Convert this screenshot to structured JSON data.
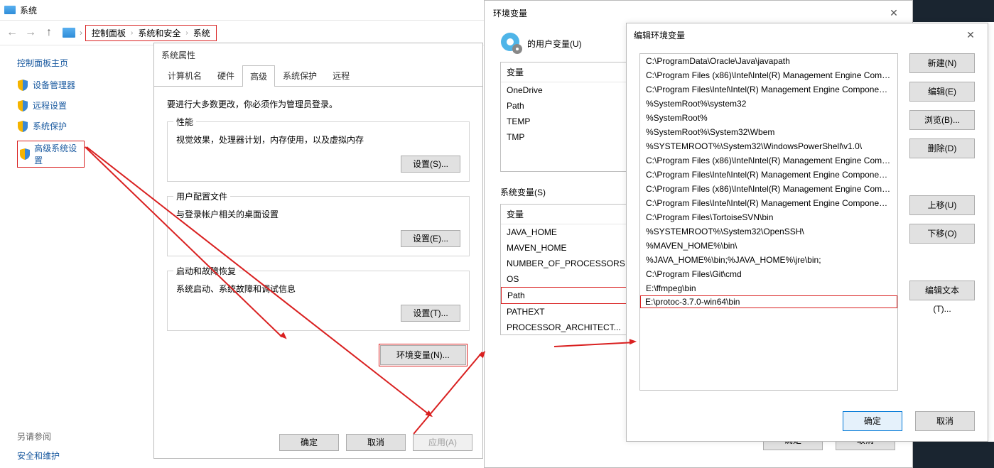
{
  "system": {
    "title": "系统",
    "breadcrumb": [
      "控制面板",
      "系统和安全",
      "系统"
    ],
    "sidebar": {
      "home": "控制面板主页",
      "items": [
        {
          "label": "设备管理器"
        },
        {
          "label": "远程设置"
        },
        {
          "label": "系统保护"
        },
        {
          "label": "高级系统设置"
        }
      ],
      "extra": [
        "另请参阅",
        "安全和维护"
      ]
    }
  },
  "sysprops": {
    "title": "系统属性",
    "tabs": [
      "计算机名",
      "硬件",
      "高级",
      "系统保护",
      "远程"
    ],
    "note": "要进行大多数更改，你必须作为管理员登录。",
    "perf": {
      "label": "性能",
      "desc": "视觉效果，处理器计划，内存使用，以及虚拟内存",
      "btn": "设置(S)..."
    },
    "profile": {
      "label": "用户配置文件",
      "desc": "与登录帐户相关的桌面设置",
      "btn": "设置(E)..."
    },
    "startup": {
      "label": "启动和故障恢复",
      "desc": "系统启动、系统故障和调试信息",
      "btn": "设置(T)..."
    },
    "envbtn": "环境变量(N)...",
    "footer": {
      "ok": "确定",
      "cancel": "取消",
      "apply": "应用(A)"
    }
  },
  "envdlg": {
    "title": "环境变量",
    "user_section": "的用户变量(U)",
    "var_header": "变量",
    "user_vars": [
      "OneDrive",
      "Path",
      "TEMP",
      "TMP"
    ],
    "sys_section": "系统变量(S)",
    "sys_vars": [
      "JAVA_HOME",
      "MAVEN_HOME",
      "NUMBER_OF_PROCESSORS",
      "OS",
      "Path",
      "PATHEXT",
      "PROCESSOR_ARCHITECT..."
    ],
    "footer": {
      "ok": "确定",
      "cancel": "取消"
    }
  },
  "editdlg": {
    "title": "编辑环境变量",
    "paths": [
      "C:\\ProgramData\\Oracle\\Java\\javapath",
      "C:\\Program Files (x86)\\Intel\\Intel(R) Management Engine Comp...",
      "C:\\Program Files\\Intel\\Intel(R) Management Engine Component...",
      "%SystemRoot%\\system32",
      "%SystemRoot%",
      "%SystemRoot%\\System32\\Wbem",
      "%SYSTEMROOT%\\System32\\WindowsPowerShell\\v1.0\\",
      "C:\\Program Files (x86)\\Intel\\Intel(R) Management Engine Comp...",
      "C:\\Program Files\\Intel\\Intel(R) Management Engine Component...",
      "C:\\Program Files (x86)\\Intel\\Intel(R) Management Engine Comp...",
      "C:\\Program Files\\Intel\\Intel(R) Management Engine Component...",
      "C:\\Program Files\\TortoiseSVN\\bin",
      "%SYSTEMROOT%\\System32\\OpenSSH\\",
      "%MAVEN_HOME%\\bin\\",
      "%JAVA_HOME%\\bin;%JAVA_HOME%\\jre\\bin;",
      "C:\\Program Files\\Git\\cmd",
      "E:\\ffmpeg\\bin",
      "E:\\protoc-3.7.0-win64\\bin"
    ],
    "buttons": {
      "new": "新建(N)",
      "edit": "编辑(E)",
      "browse": "浏览(B)...",
      "delete": "删除(D)",
      "up": "上移(U)",
      "down": "下移(O)",
      "edittext": "编辑文本(T)..."
    },
    "footer": {
      "ok": "确定",
      "cancel": "取消"
    }
  }
}
